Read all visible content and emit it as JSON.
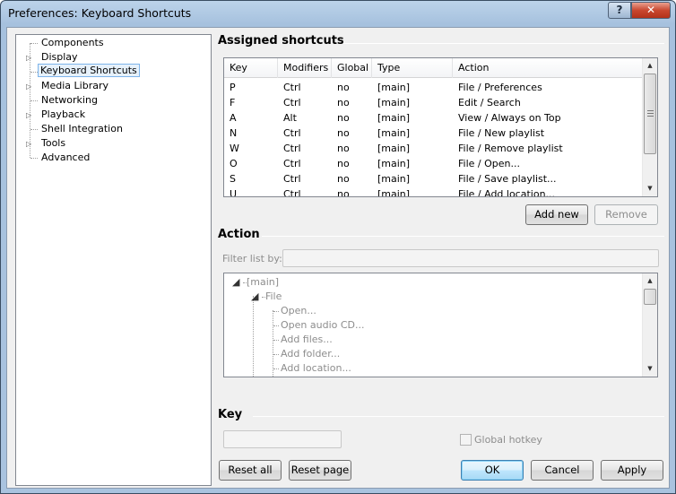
{
  "window": {
    "title": "Preferences: Keyboard Shortcuts",
    "help_label": "?",
    "close_label": "✕"
  },
  "tree": {
    "items": [
      {
        "label": "Components",
        "expandable": false
      },
      {
        "label": "Display",
        "expandable": true
      },
      {
        "label": "Keyboard Shortcuts",
        "expandable": false,
        "selected": true
      },
      {
        "label": "Media Library",
        "expandable": true
      },
      {
        "label": "Networking",
        "expandable": false
      },
      {
        "label": "Playback",
        "expandable": true
      },
      {
        "label": "Shell Integration",
        "expandable": false
      },
      {
        "label": "Tools",
        "expandable": true
      },
      {
        "label": "Advanced",
        "expandable": false
      }
    ]
  },
  "assigned": {
    "title": "Assigned shortcuts",
    "columns": [
      "Key",
      "Modifiers",
      "Global",
      "Type",
      "Action"
    ],
    "rows": [
      [
        "P",
        "Ctrl",
        "no",
        "[main]",
        "File / Preferences"
      ],
      [
        "F",
        "Ctrl",
        "no",
        "[main]",
        "Edit / Search"
      ],
      [
        "A",
        "Alt",
        "no",
        "[main]",
        "View / Always on Top"
      ],
      [
        "N",
        "Ctrl",
        "no",
        "[main]",
        "File / New playlist"
      ],
      [
        "W",
        "Ctrl",
        "no",
        "[main]",
        "File / Remove playlist"
      ],
      [
        "O",
        "Ctrl",
        "no",
        "[main]",
        "File / Open..."
      ],
      [
        "S",
        "Ctrl",
        "no",
        "[main]",
        "File / Save playlist..."
      ],
      [
        "U",
        "Ctrl",
        "no",
        "[main]",
        "File / Add location..."
      ]
    ],
    "add_new": "Add new",
    "remove": "Remove"
  },
  "action": {
    "title": "Action",
    "filter_label": "Filter list by:",
    "filter_value": "",
    "tree": {
      "root": "[main]",
      "group": "File",
      "items": [
        "Open...",
        "Open audio CD...",
        "Add files...",
        "Add folder...",
        "Add location..."
      ]
    }
  },
  "key": {
    "title": "Key",
    "value": "",
    "global_hotkey": "Global hotkey"
  },
  "footer": {
    "reset_all": "Reset all",
    "reset_page": "Reset page",
    "ok": "OK",
    "cancel": "Cancel",
    "apply": "Apply"
  }
}
